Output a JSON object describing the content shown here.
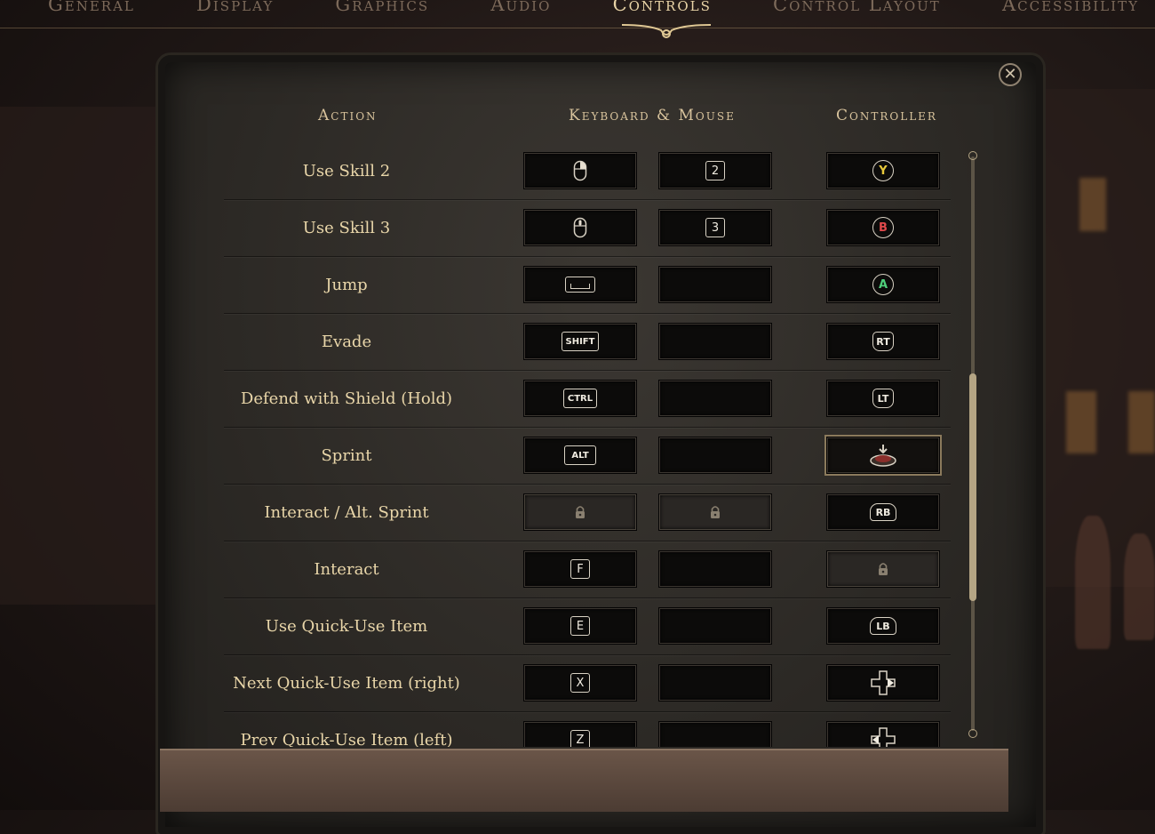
{
  "nav": {
    "tabs": [
      {
        "label": "General",
        "active": false
      },
      {
        "label": "Display",
        "active": false
      },
      {
        "label": "Graphics",
        "active": false
      },
      {
        "label": "Audio",
        "active": false
      },
      {
        "label": "Controls",
        "active": true
      },
      {
        "label": "Control Layout",
        "active": false
      },
      {
        "label": "Accessibility",
        "active": false
      }
    ]
  },
  "headers": {
    "action": "Action",
    "keyboard": "Keyboard & Mouse",
    "controller": "Controller"
  },
  "colors": {
    "accent": "#e8d3a6",
    "btn_y": "#e8c93a",
    "btn_b": "#e0494b",
    "btn_a": "#4fcf7b"
  },
  "rows": [
    {
      "action": "Use Skill 2",
      "kb1": {
        "type": "icon",
        "icon": "mouse-right-icon"
      },
      "kb2": {
        "type": "key",
        "label": "2"
      },
      "ctrl": {
        "type": "face",
        "label": "Y",
        "color": "#e8c93a"
      }
    },
    {
      "action": "Use Skill 3",
      "kb1": {
        "type": "icon",
        "icon": "mouse-middle-icon"
      },
      "kb2": {
        "type": "key",
        "label": "3"
      },
      "ctrl": {
        "type": "face",
        "label": "B",
        "color": "#e0494b"
      }
    },
    {
      "action": "Jump",
      "kb1": {
        "type": "space",
        "icon": "spacebar-icon"
      },
      "kb2": {
        "type": "empty"
      },
      "ctrl": {
        "type": "face",
        "label": "A",
        "color": "#4fcf7b"
      }
    },
    {
      "action": "Evade",
      "kb1": {
        "type": "wide",
        "label": "SHIFT"
      },
      "kb2": {
        "type": "empty"
      },
      "ctrl": {
        "type": "trigger",
        "label": "RT"
      }
    },
    {
      "action": "Defend with Shield (Hold)",
      "kb1": {
        "type": "wide",
        "label": "CTRL"
      },
      "kb2": {
        "type": "empty"
      },
      "ctrl": {
        "type": "trigger",
        "label": "LT"
      }
    },
    {
      "action": "Sprint",
      "kb1": {
        "type": "wide",
        "label": "ALT"
      },
      "kb2": {
        "type": "empty"
      },
      "ctrl": {
        "type": "icon",
        "icon": "left-stick-press-icon",
        "selected": true
      }
    },
    {
      "action": "Interact / Alt. Sprint",
      "kb1": {
        "type": "locked",
        "icon": "lock-icon"
      },
      "kb2": {
        "type": "locked",
        "icon": "lock-icon"
      },
      "ctrl": {
        "type": "bumper",
        "label": "RB"
      }
    },
    {
      "action": "Interact",
      "kb1": {
        "type": "key",
        "label": "F"
      },
      "kb2": {
        "type": "empty"
      },
      "ctrl": {
        "type": "locked",
        "icon": "lock-icon"
      }
    },
    {
      "action": "Use Quick-Use Item",
      "kb1": {
        "type": "key",
        "label": "E"
      },
      "kb2": {
        "type": "empty"
      },
      "ctrl": {
        "type": "bumper",
        "label": "LB"
      }
    },
    {
      "action": "Next Quick-Use Item (right)",
      "kb1": {
        "type": "key",
        "label": "X"
      },
      "kb2": {
        "type": "empty"
      },
      "ctrl": {
        "type": "icon",
        "icon": "dpad-right-icon"
      }
    },
    {
      "action": "Prev Quick-Use Item (left)",
      "kb1": {
        "type": "key",
        "label": "Z"
      },
      "kb2": {
        "type": "empty"
      },
      "ctrl": {
        "type": "icon",
        "icon": "dpad-left-icon"
      }
    }
  ]
}
